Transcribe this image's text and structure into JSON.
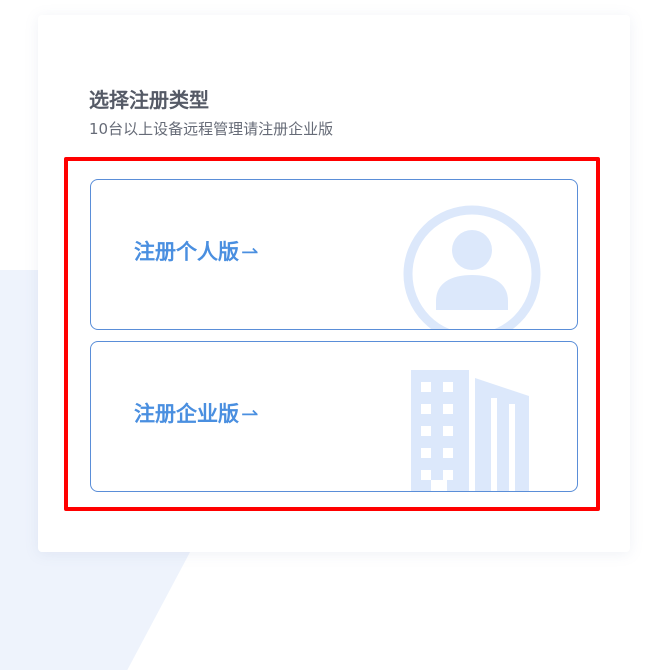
{
  "page": {
    "title": "选择注册类型",
    "subtitle": "10台以上设备远程管理请注册企业版"
  },
  "options": [
    {
      "label": "注册个人版",
      "arrow": "⇀",
      "icon": "person-avatar-icon"
    },
    {
      "label": "注册企业版",
      "arrow": "⇀",
      "icon": "building-icon"
    }
  ],
  "colors": {
    "accent": "#4a8fe0",
    "border": "#5a8ed8",
    "icon_fill": "#dce8fb",
    "highlight": "#ff0000",
    "title": "#555a66"
  }
}
